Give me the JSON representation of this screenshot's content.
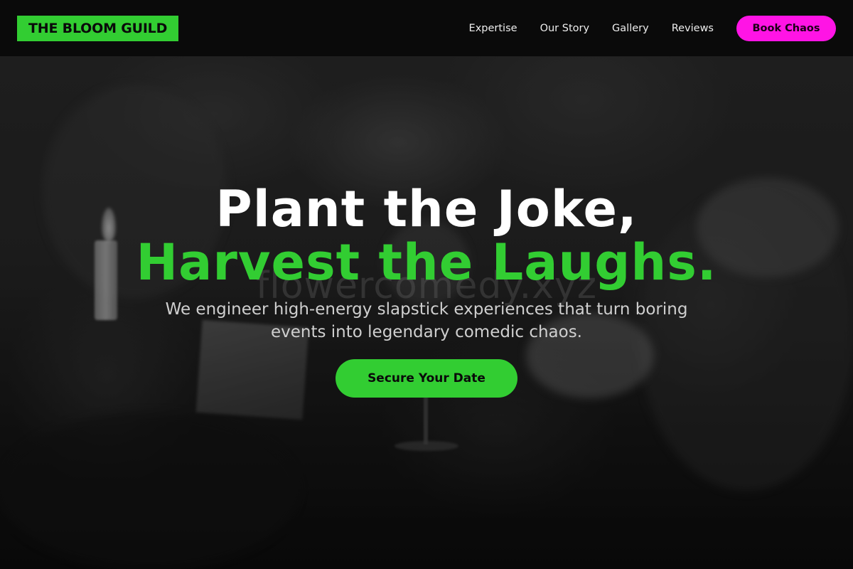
{
  "header": {
    "logo_text": "THE BLOOM GUILD",
    "nav": [
      {
        "label": "Expertise"
      },
      {
        "label": "Our Story"
      },
      {
        "label": "Gallery"
      },
      {
        "label": "Reviews"
      }
    ],
    "cta_label": "Book Chaos"
  },
  "hero": {
    "headline_line1": "Plant the Joke,",
    "headline_line2": "Harvest the Laughs.",
    "subheading": "We engineer high-energy slapstick experiences that turn boring events into legendary comedic chaos.",
    "cta_label": "Secure Your Date",
    "watermark": "flowercomedy.xyz",
    "background_image": "blurred dinner party toast"
  },
  "colors": {
    "accent_green": "#32cd32",
    "accent_magenta": "#ff14e5",
    "background": "#0a0a0a",
    "text_white": "#ffffff",
    "text_muted": "#cfcfcf"
  }
}
